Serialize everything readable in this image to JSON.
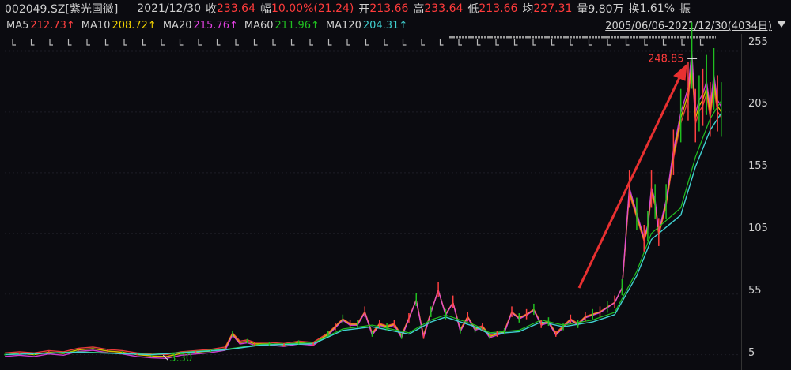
{
  "quote": {
    "code": "002049.SZ[紫光国微]",
    "date": "2021/12/30",
    "close_label": "收",
    "close_value": "233.64",
    "change_label": "幅",
    "change_value": "10.00%(21.24)",
    "open_label": "开",
    "open_value": "213.66",
    "high_label": "高",
    "high_value": "233.64",
    "low_label": "低",
    "low_value": "213.66",
    "avg_label": "均",
    "avg_value": "227.31",
    "volume_label": "量",
    "volume_value": "9.80万",
    "turnover_label": "换",
    "turnover_value": "1.61%",
    "amplitude_label": "振"
  },
  "indicators": [
    {
      "name": "MA5",
      "value": "212.73↑",
      "color": "#ff4040"
    },
    {
      "name": "MA10",
      "value": "208.72↑",
      "color": "#f0d000"
    },
    {
      "name": "MA20",
      "value": "215.76↑",
      "color": "#e040e0"
    },
    {
      "name": "MA60",
      "value": "211.96↑",
      "color": "#20c020"
    },
    {
      "name": "MA120",
      "value": "204.31↑",
      "color": "#40d0d0"
    }
  ],
  "date_range": "2005/06/06-2021/12/30(4034日)",
  "chart_data": {
    "type": "line",
    "title": "",
    "ylabel": "",
    "y_ticks": [
      "255",
      "205",
      "155",
      "105",
      "55",
      "5"
    ],
    "ylim": [
      -5,
      268
    ],
    "annotations": [
      {
        "label": "248.85",
        "x": 0.942,
        "y": 248.85,
        "color": "#ff3b3b"
      },
      {
        "label": "3.30",
        "x": 0.222,
        "y": 3.3,
        "color": "#20c020"
      }
    ],
    "series": [
      {
        "name": "price",
        "x": [
          0,
          0.02,
          0.04,
          0.06,
          0.08,
          0.1,
          0.12,
          0.14,
          0.16,
          0.18,
          0.2,
          0.22,
          0.24,
          0.26,
          0.28,
          0.3,
          0.31,
          0.32,
          0.33,
          0.34,
          0.36,
          0.38,
          0.4,
          0.42,
          0.44,
          0.45,
          0.46,
          0.47,
          0.48,
          0.49,
          0.5,
          0.51,
          0.52,
          0.53,
          0.54,
          0.55,
          0.56,
          0.57,
          0.58,
          0.59,
          0.6,
          0.61,
          0.62,
          0.63,
          0.64,
          0.65,
          0.66,
          0.67,
          0.68,
          0.69,
          0.7,
          0.71,
          0.72,
          0.73,
          0.74,
          0.75,
          0.76,
          0.77,
          0.78,
          0.79,
          0.8,
          0.81,
          0.82,
          0.83,
          0.84,
          0.85,
          0.86,
          0.87,
          0.875,
          0.88,
          0.885,
          0.89,
          0.9,
          0.91,
          0.92,
          0.93,
          0.935,
          0.94,
          0.945,
          0.95,
          0.955,
          0.96,
          0.965,
          0.97,
          0.975
        ],
        "values": [
          5,
          6,
          5,
          7,
          6,
          9,
          10,
          8,
          7,
          5,
          4,
          3.5,
          6,
          7,
          8,
          10,
          22,
          15,
          16,
          14,
          14,
          13,
          15,
          14,
          22,
          28,
          34,
          30,
          30,
          40,
          22,
          30,
          28,
          30,
          20,
          35,
          50,
          20,
          40,
          58,
          38,
          48,
          25,
          36,
          26,
          28,
          20,
          22,
          24,
          40,
          35,
          38,
          42,
          30,
          32,
          22,
          28,
          34,
          30,
          36,
          38,
          40,
          44,
          48,
          60,
          140,
          120,
          100,
          110,
          140,
          130,
          105,
          130,
          170,
          200,
          220,
          249,
          200,
          210,
          215,
          225,
          205,
          230,
          210,
          205
        ]
      },
      {
        "name": "MA120",
        "x": [
          0,
          0.1,
          0.2,
          0.3,
          0.35,
          0.42,
          0.46,
          0.5,
          0.55,
          0.58,
          0.6,
          0.64,
          0.66,
          0.7,
          0.73,
          0.76,
          0.8,
          0.83,
          0.86,
          0.88,
          0.9,
          0.92,
          0.94,
          0.96,
          0.975
        ],
        "values": [
          5,
          7,
          5,
          9,
          13,
          14,
          25,
          28,
          22,
          32,
          36,
          28,
          22,
          24,
          32,
          28,
          32,
          38,
          70,
          100,
          110,
          120,
          160,
          190,
          204
        ]
      }
    ]
  }
}
